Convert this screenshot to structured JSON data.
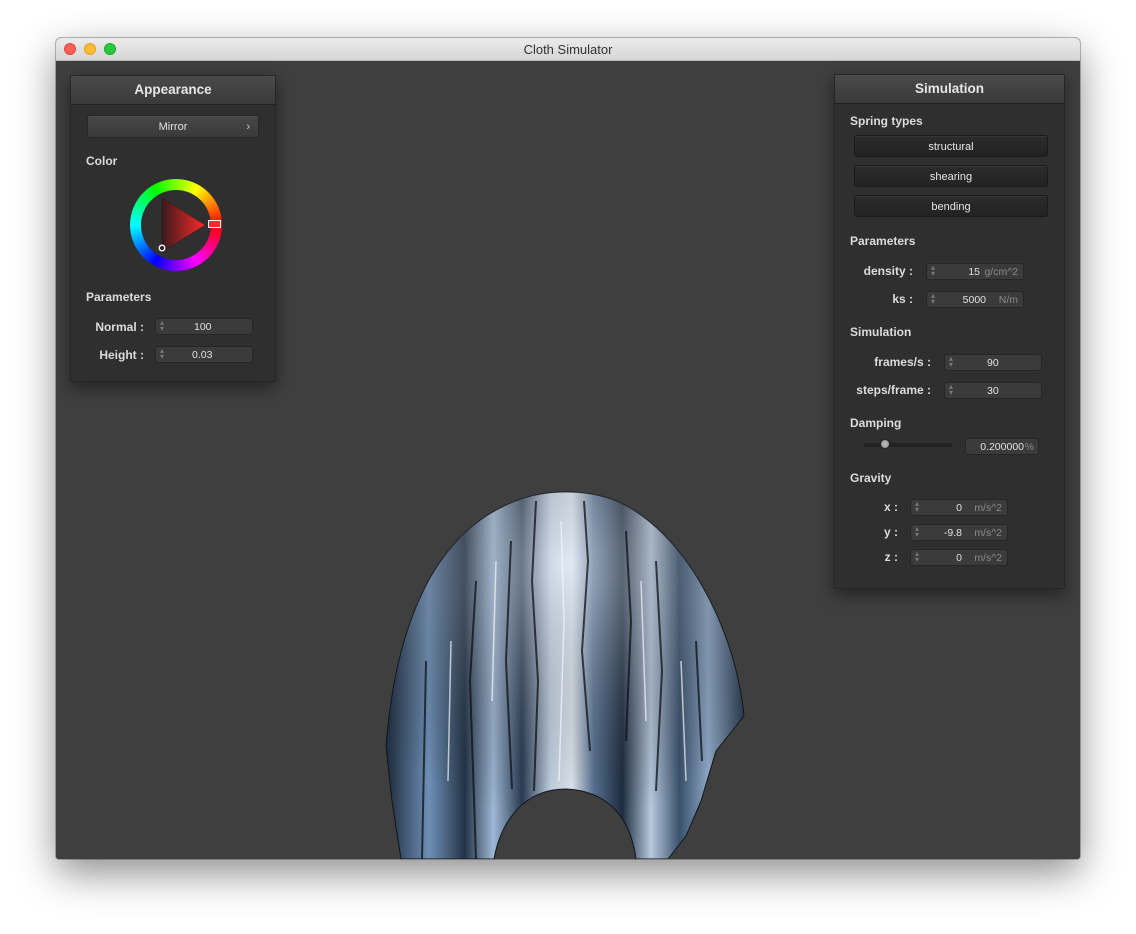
{
  "window": {
    "title": "Cloth Simulator"
  },
  "appearance": {
    "title": "Appearance",
    "shader_dropdown": {
      "selected": "Mirror",
      "chevron": "›"
    },
    "color_label": "Color",
    "parameters_label": "Parameters",
    "normal": {
      "label": "Normal :",
      "value": "100"
    },
    "height": {
      "label": "Height :",
      "value": "0.03"
    },
    "color_value": "#ff3333"
  },
  "simulation": {
    "title": "Simulation",
    "spring_types_label": "Spring types",
    "spring_buttons": [
      "structural",
      "shearing",
      "bending"
    ],
    "parameters_label": "Parameters",
    "density": {
      "label": "density :",
      "value": "15",
      "unit": "g/cm^2"
    },
    "ks": {
      "label": "ks :",
      "value": "5000",
      "unit": "N/m"
    },
    "simulation_label": "Simulation",
    "frames": {
      "label": "frames/s :",
      "value": "90"
    },
    "steps": {
      "label": "steps/frame :",
      "value": "30"
    },
    "damping_label": "Damping",
    "damping": {
      "value": "0.200000",
      "unit": "%",
      "slider_fraction": 0.2
    },
    "gravity_label": "Gravity",
    "gravity": [
      {
        "label": "x :",
        "value": "0",
        "unit": "m/s^2"
      },
      {
        "label": "y :",
        "value": "-9.8",
        "unit": "m/s^2"
      },
      {
        "label": "z :",
        "value": "0",
        "unit": "m/s^2"
      }
    ]
  }
}
